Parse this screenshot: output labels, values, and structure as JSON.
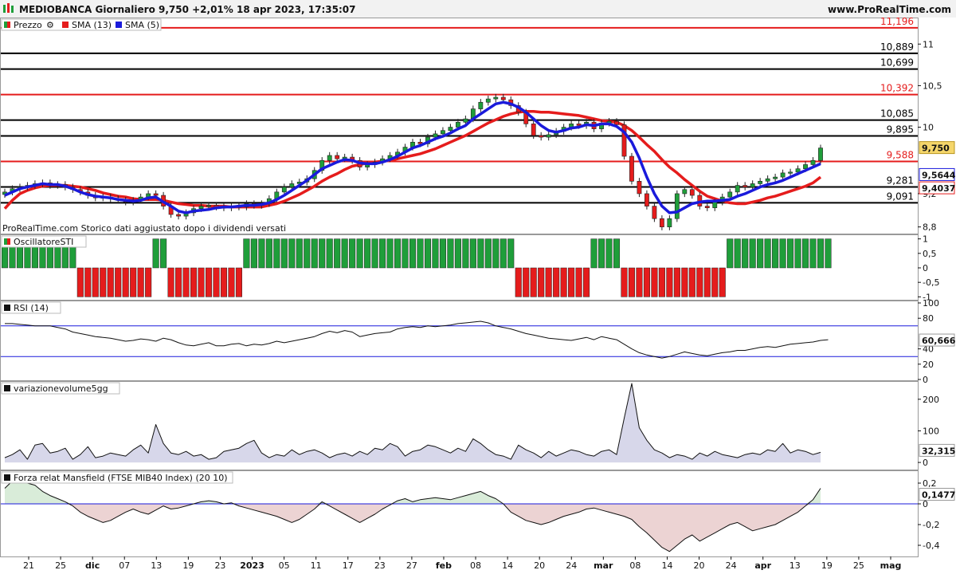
{
  "header": {
    "title": "MEDIOBANCA Giornaliero 9,750 +2,01% 18 apr 2023, 17:35:07",
    "site": "www.ProRealTime.com"
  },
  "colors": {
    "up": "#1f9e3a",
    "down": "#e51c1c",
    "sma13": "#e51c1c",
    "sma5": "#1a1adb",
    "level_red": "#e51c1c",
    "level_black": "#000000",
    "rsi_band": "#1a1adb",
    "vol_fill": "#d7d7ea",
    "pos_fill": "#d9ecd9",
    "neg_fill": "#ecd3d3"
  },
  "price_panel": {
    "legend": [
      {
        "icon": "price-icon",
        "label": "Prezzo"
      },
      {
        "icon": "wrench-icon",
        "label": "SMA (13)"
      },
      {
        "icon": "wrench-icon",
        "label": "SMA (5)"
      }
    ],
    "note": "ProRealTime.com  Storico dati aggiustato dopo i dividendi versati",
    "y_ticks": [
      "11",
      "10,5",
      "10",
      "9,2",
      "8,8"
    ],
    "levels": [
      {
        "value": "11,196",
        "v": 11.196,
        "color": "red"
      },
      {
        "value": "10,889",
        "v": 10.889,
        "color": "black"
      },
      {
        "value": "10,699",
        "v": 10.699,
        "color": "black"
      },
      {
        "value": "10,392",
        "v": 10.392,
        "color": "red"
      },
      {
        "value": "10,085",
        "v": 10.085,
        "color": "black"
      },
      {
        "value": "9,895",
        "v": 9.895,
        "color": "black"
      },
      {
        "value": "9,588",
        "v": 9.588,
        "color": "red"
      },
      {
        "value": "9,281",
        "v": 9.281,
        "color": "black"
      },
      {
        "value": "9,091",
        "v": 9.091,
        "color": "black"
      }
    ],
    "price_badge": "9,750",
    "sma5_badge": "9,5644",
    "sma13_badge": "9,4037"
  },
  "sti_panel": {
    "legend": "OscillatoreSTI",
    "y_ticks": [
      "1",
      "0,5",
      "0",
      "-0,5",
      "-1"
    ]
  },
  "rsi_panel": {
    "legend": "RSI (14)",
    "y_ticks": [
      "100",
      "80",
      "40",
      "20",
      "0"
    ],
    "value_badge": "60,666"
  },
  "vol_panel": {
    "legend": "variazionevolume5gg",
    "y_ticks": [
      "200",
      "100",
      "0"
    ],
    "value_badge": "32,315"
  },
  "mansfield_panel": {
    "legend": "Forza relat Mansfield (FTSE MIB40 Index) (20 10)",
    "y_ticks": [
      "0,2",
      "0",
      "-0,2",
      "-0,4"
    ],
    "value_badge": "0,1477"
  },
  "x_ticks": [
    {
      "label": "21",
      "bold": false
    },
    {
      "label": "25",
      "bold": false
    },
    {
      "label": "dic",
      "bold": true
    },
    {
      "label": "07",
      "bold": false
    },
    {
      "label": "13",
      "bold": false
    },
    {
      "label": "19",
      "bold": false
    },
    {
      "label": "23",
      "bold": false
    },
    {
      "label": "2023",
      "bold": true
    },
    {
      "label": "05",
      "bold": false
    },
    {
      "label": "11",
      "bold": false
    },
    {
      "label": "17",
      "bold": false
    },
    {
      "label": "23",
      "bold": false
    },
    {
      "label": "27",
      "bold": false
    },
    {
      "label": "feb",
      "bold": true
    },
    {
      "label": "08",
      "bold": false
    },
    {
      "label": "14",
      "bold": false
    },
    {
      "label": "20",
      "bold": false
    },
    {
      "label": "24",
      "bold": false
    },
    {
      "label": "mar",
      "bold": true
    },
    {
      "label": "08",
      "bold": false
    },
    {
      "label": "14",
      "bold": false
    },
    {
      "label": "20",
      "bold": false
    },
    {
      "label": "24",
      "bold": false
    },
    {
      "label": "apr",
      "bold": true
    },
    {
      "label": "13",
      "bold": false
    },
    {
      "label": "19",
      "bold": false
    },
    {
      "label": "25",
      "bold": false
    },
    {
      "label": "mag",
      "bold": true
    }
  ],
  "chart_data": [
    {
      "type": "candlestick",
      "title": "MEDIOBANCA Giornaliero",
      "ylim": [
        8.72,
        11.3
      ],
      "close": [
        9.22,
        9.26,
        9.28,
        9.3,
        9.32,
        9.33,
        9.3,
        9.31,
        9.28,
        9.25,
        9.22,
        9.18,
        9.15,
        9.16,
        9.14,
        9.12,
        9.1,
        9.12,
        9.16,
        9.2,
        9.18,
        9.05,
        8.95,
        8.93,
        8.97,
        9.02,
        9.05,
        9.06,
        9.04,
        9.03,
        9.05,
        9.04,
        9.08,
        9.06,
        9.08,
        9.14,
        9.22,
        9.28,
        9.32,
        9.34,
        9.38,
        9.48,
        9.6,
        9.66,
        9.62,
        9.64,
        9.6,
        9.52,
        9.55,
        9.58,
        9.62,
        9.66,
        9.7,
        9.76,
        9.82,
        9.8,
        9.88,
        9.92,
        9.96,
        10.0,
        10.06,
        10.1,
        10.22,
        10.3,
        10.34,
        10.36,
        10.33,
        10.26,
        10.18,
        10.04,
        9.9,
        9.88,
        9.91,
        9.95,
        10.0,
        10.04,
        10.02,
        10.06,
        9.98,
        10.05,
        10.07,
        10.03,
        9.65,
        9.35,
        9.2,
        9.05,
        8.9,
        8.8,
        8.9,
        9.2,
        9.25,
        9.18,
        9.05,
        9.03,
        9.1,
        9.16,
        9.22,
        9.3,
        9.28,
        9.32,
        9.35,
        9.38,
        9.4,
        9.45,
        9.46,
        9.5,
        9.55,
        9.6,
        9.75
      ]
    },
    {
      "type": "line",
      "name": "SMA (13)",
      "values": [
        9.02,
        9.12,
        9.2,
        9.24,
        9.27,
        9.29,
        9.3,
        9.3,
        9.3,
        9.29,
        9.28,
        9.26,
        9.24,
        9.21,
        9.19,
        9.17,
        9.16,
        9.14,
        9.13,
        9.13,
        9.13,
        9.12,
        9.1,
        9.08,
        9.07,
        9.06,
        9.06,
        9.05,
        9.05,
        9.05,
        9.04,
        9.04,
        9.04,
        9.04,
        9.04,
        9.06,
        9.08,
        9.11,
        9.15,
        9.19,
        9.24,
        9.29,
        9.35,
        9.4,
        9.44,
        9.49,
        9.53,
        9.55,
        9.57,
        9.58,
        9.59,
        9.6,
        9.62,
        9.64,
        9.66,
        9.68,
        9.71,
        9.74,
        9.78,
        9.82,
        9.86,
        9.9,
        9.95,
        10.0,
        10.05,
        10.09,
        10.13,
        10.16,
        10.18,
        10.19,
        10.19,
        10.18,
        10.18,
        10.17,
        10.16,
        10.15,
        10.14,
        10.12,
        10.1,
        10.08,
        10.07,
        10.06,
        10.02,
        9.96,
        9.88,
        9.79,
        9.71,
        9.61,
        9.52,
        9.45,
        9.37,
        9.3,
        9.23,
        9.17,
        9.14,
        9.11,
        9.09,
        9.08,
        9.08,
        9.1,
        9.12,
        9.15,
        9.17,
        9.2,
        9.23,
        9.26,
        9.29,
        9.33,
        9.4
      ]
    },
    {
      "type": "line",
      "name": "SMA (5)",
      "values": [
        9.18,
        9.22,
        9.26,
        9.28,
        9.3,
        9.32,
        9.31,
        9.31,
        9.29,
        9.26,
        9.22,
        9.19,
        9.17,
        9.16,
        9.15,
        9.13,
        9.12,
        9.11,
        9.12,
        9.15,
        9.16,
        9.1,
        9.05,
        8.99,
        8.97,
        8.99,
        9.0,
        9.01,
        9.03,
        9.04,
        9.04,
        9.05,
        9.06,
        9.06,
        9.07,
        9.09,
        9.13,
        9.18,
        9.24,
        9.3,
        9.36,
        9.43,
        9.5,
        9.54,
        9.58,
        9.61,
        9.6,
        9.57,
        9.56,
        9.56,
        9.58,
        9.61,
        9.65,
        9.7,
        9.75,
        9.78,
        9.82,
        9.86,
        9.89,
        9.93,
        9.98,
        10.02,
        10.1,
        10.16,
        10.22,
        10.28,
        10.3,
        10.28,
        10.24,
        10.18,
        10.1,
        10.02,
        9.96,
        9.94,
        9.96,
        9.99,
        10.0,
        10.03,
        10.02,
        10.04,
        10.04,
        10.01,
        9.94,
        9.82,
        9.63,
        9.4,
        9.2,
        9.05,
        8.97,
        8.98,
        9.03,
        9.08,
        9.1,
        9.11,
        9.11,
        9.12,
        9.13,
        9.17,
        9.2,
        9.24,
        9.28,
        9.31,
        9.33,
        9.36,
        9.4,
        9.44,
        9.48,
        9.52,
        9.56
      ]
    },
    {
      "type": "bar",
      "name": "OscillatoreSTI",
      "ylim": [
        -1,
        1
      ],
      "values": [
        1,
        1,
        1,
        1,
        1,
        1,
        1,
        1,
        1,
        1,
        -1,
        -1,
        -1,
        -1,
        -1,
        -1,
        -1,
        -1,
        -1,
        -1,
        1,
        1,
        -1,
        -1,
        -1,
        -1,
        -1,
        -1,
        -1,
        -1,
        -1,
        -1,
        1,
        1,
        1,
        1,
        1,
        1,
        1,
        1,
        1,
        1,
        1,
        1,
        1,
        1,
        1,
        1,
        1,
        1,
        1,
        1,
        1,
        1,
        1,
        1,
        1,
        1,
        1,
        1,
        1,
        1,
        1,
        1,
        1,
        1,
        1,
        1,
        -1,
        -1,
        -1,
        -1,
        -1,
        -1,
        -1,
        -1,
        -1,
        -1,
        1,
        1,
        1,
        1,
        -1,
        -1,
        -1,
        -1,
        -1,
        -1,
        -1,
        -1,
        -1,
        -1,
        -1,
        -1,
        -1,
        -1,
        1,
        1,
        1,
        1,
        1,
        1,
        1,
        1,
        1,
        1,
        1,
        1,
        1,
        1
      ]
    },
    {
      "type": "line",
      "name": "RSI (14)",
      "ylim": [
        0,
        100
      ],
      "bands": [
        30,
        70
      ],
      "values": [
        73,
        73,
        72,
        71,
        70,
        70,
        70,
        68,
        66,
        62,
        60,
        58,
        56,
        55,
        54,
        52,
        50,
        51,
        53,
        52,
        50,
        54,
        52,
        48,
        45,
        44,
        46,
        48,
        44,
        44,
        46,
        47,
        44,
        46,
        45,
        47,
        50,
        48,
        50,
        52,
        54,
        56,
        60,
        63,
        61,
        64,
        62,
        56,
        58,
        60,
        61,
        62,
        66,
        68,
        69,
        68,
        70,
        69,
        70,
        71,
        73,
        74,
        75,
        76,
        74,
        70,
        68,
        66,
        63,
        60,
        58,
        56,
        54,
        53,
        52,
        51,
        53,
        55,
        52,
        56,
        54,
        52,
        46,
        40,
        35,
        32,
        30,
        28,
        30,
        33,
        36,
        34,
        32,
        31,
        33,
        35,
        36,
        38,
        38,
        40,
        42,
        43,
        42,
        44,
        46,
        47,
        48,
        49,
        51,
        52
      ]
    },
    {
      "type": "area",
      "name": "variazionevolume5gg",
      "ylim": [
        -20,
        250
      ],
      "values": [
        15,
        25,
        40,
        10,
        55,
        60,
        30,
        35,
        45,
        10,
        25,
        50,
        15,
        20,
        30,
        25,
        20,
        40,
        55,
        30,
        120,
        60,
        30,
        25,
        35,
        20,
        25,
        10,
        15,
        35,
        40,
        45,
        60,
        70,
        30,
        15,
        25,
        20,
        40,
        25,
        35,
        40,
        30,
        15,
        25,
        30,
        20,
        35,
        25,
        45,
        40,
        60,
        50,
        20,
        35,
        40,
        55,
        50,
        40,
        30,
        45,
        35,
        75,
        60,
        40,
        25,
        20,
        10,
        55,
        40,
        30,
        15,
        35,
        20,
        30,
        40,
        35,
        25,
        20,
        35,
        40,
        25,
        140,
        250,
        110,
        70,
        40,
        30,
        15,
        25,
        20,
        10,
        30,
        20,
        35,
        25,
        20,
        15,
        25,
        30,
        25,
        40,
        35,
        60,
        30,
        40,
        35,
        25,
        32
      ]
    },
    {
      "type": "area",
      "name": "Forza relat Mansfield (FTSE MIB40 Index) (20 10)",
      "ylim": [
        -0.5,
        0.3
      ],
      "values": [
        0.15,
        0.22,
        0.25,
        0.2,
        0.18,
        0.12,
        0.08,
        0.05,
        0.02,
        -0.02,
        -0.08,
        -0.12,
        -0.15,
        -0.18,
        -0.16,
        -0.12,
        -0.08,
        -0.05,
        -0.08,
        -0.1,
        -0.06,
        -0.02,
        -0.05,
        -0.04,
        -0.02,
        0.0,
        0.02,
        0.03,
        0.02,
        0.0,
        0.01,
        -0.02,
        -0.04,
        -0.06,
        -0.08,
        -0.1,
        -0.12,
        -0.15,
        -0.18,
        -0.15,
        -0.1,
        -0.05,
        0.02,
        -0.02,
        -0.06,
        -0.1,
        -0.14,
        -0.18,
        -0.14,
        -0.1,
        -0.05,
        -0.01,
        0.03,
        0.05,
        0.02,
        0.04,
        0.05,
        0.06,
        0.05,
        0.04,
        0.06,
        0.08,
        0.1,
        0.12,
        0.08,
        0.05,
        0.0,
        -0.08,
        -0.12,
        -0.16,
        -0.18,
        -0.2,
        -0.18,
        -0.15,
        -0.12,
        -0.1,
        -0.08,
        -0.05,
        -0.04,
        -0.06,
        -0.08,
        -0.1,
        -0.12,
        -0.15,
        -0.22,
        -0.28,
        -0.35,
        -0.42,
        -0.46,
        -0.4,
        -0.34,
        -0.3,
        -0.36,
        -0.32,
        -0.28,
        -0.24,
        -0.2,
        -0.18,
        -0.22,
        -0.26,
        -0.24,
        -0.22,
        -0.2,
        -0.16,
        -0.12,
        -0.08,
        -0.02,
        0.04,
        0.15
      ]
    }
  ]
}
